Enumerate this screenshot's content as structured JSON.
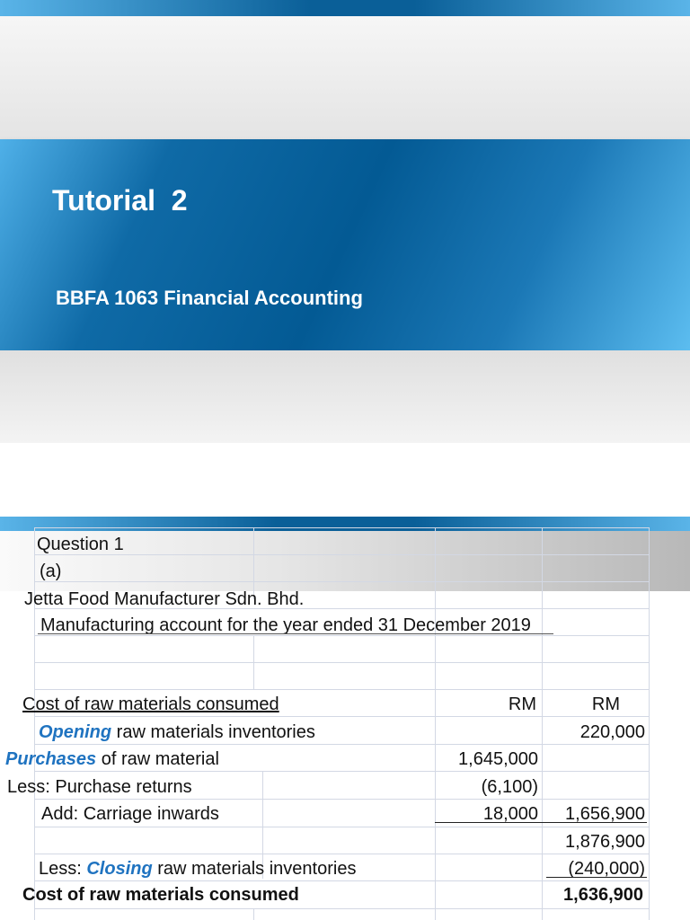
{
  "slide1": {
    "title": "Tutorial  2",
    "subtitle": "BBFA 1063 Financial Accounting"
  },
  "slide2": {
    "question": "Question 1",
    "part": "(a)",
    "company": "Jetta Food Manufacturer Sdn. Bhd.",
    "statement_title": "Manufacturing account for the year ended 31 December 2019",
    "section_heading": "Cost of raw materials consumed",
    "col_headers": [
      "RM",
      "RM"
    ],
    "rows": [
      {
        "emph": "Opening",
        "label": " raw materials inventories",
        "col1": "",
        "col2": "220,000"
      },
      {
        "emph": "Purchases",
        "label": " of raw material",
        "col1": "1,645,000",
        "col2": ""
      },
      {
        "emph": "",
        "label": "Less: Purchase returns",
        "col1": "(6,100)",
        "col2": ""
      },
      {
        "emph": "",
        "label": "Add: Carriage inwards",
        "col1": "18,000",
        "col2": "1,656,900"
      },
      {
        "emph": "",
        "label": "",
        "col1": "",
        "col2": "1,876,900"
      },
      {
        "prefix": "Less: ",
        "emph": "Closing",
        "label": " raw materials inventories",
        "col1": "",
        "col2": "(240,000)"
      }
    ],
    "total": {
      "label": "Cost of raw materials consumed",
      "value": "1,636,900"
    }
  }
}
